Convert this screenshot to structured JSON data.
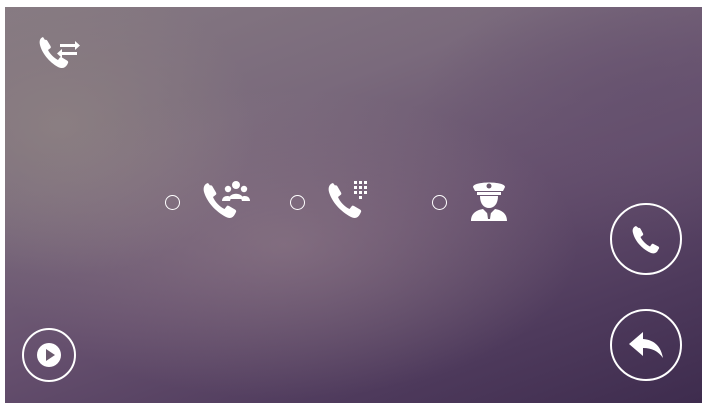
{
  "toolbar": {
    "transfer_icon": "call-transfer-icon"
  },
  "options": [
    {
      "id": "group-call",
      "icon": "phone-group-icon",
      "selected": false
    },
    {
      "id": "dial-call",
      "icon": "phone-keypad-icon",
      "selected": false
    },
    {
      "id": "guard-call",
      "icon": "security-guard-icon",
      "selected": false
    }
  ],
  "actions": {
    "play_icon": "play-icon",
    "call_icon": "phone-icon",
    "back_icon": "back-arrow-icon"
  },
  "colors": {
    "foreground": "#ffffff"
  }
}
